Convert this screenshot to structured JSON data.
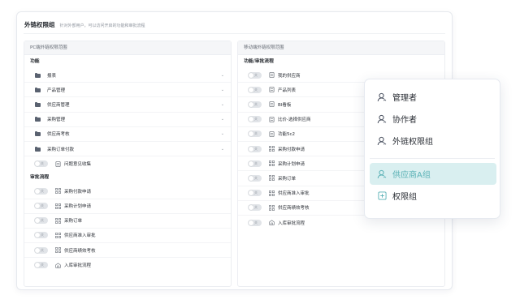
{
  "card": {
    "title": "外链权限组",
    "description": "针对外部用户，可以访问开启的功能和审批流程"
  },
  "left_panel": {
    "header": "PC端外链权限范围",
    "functions_label": "功能",
    "function_items": [
      {
        "label": "报表"
      },
      {
        "label": "产品管理"
      },
      {
        "label": "供应商管理"
      },
      {
        "label": "采购管理"
      },
      {
        "label": "供应商考核"
      },
      {
        "label": "采购订单付款"
      }
    ],
    "function_toggle_items": [
      {
        "label": "问题意见收集",
        "toggle_text": "关"
      }
    ],
    "approval_label": "审批流程",
    "approval_items": [
      {
        "label": "采购付款申请",
        "toggle_text": "关"
      },
      {
        "label": "采购计划申请",
        "toggle_text": "关"
      },
      {
        "label": "采购订单",
        "toggle_text": "关"
      },
      {
        "label": "供应商准入审批",
        "toggle_text": "关"
      },
      {
        "label": "供应商绩效考核",
        "toggle_text": "关"
      },
      {
        "label": "入库审批流程",
        "toggle_text": "关"
      }
    ]
  },
  "right_panel": {
    "header": "移动端外链权限范围",
    "section_label": "功能/审批流程",
    "items": [
      {
        "label": "我的供应商",
        "toggle_text": "关"
      },
      {
        "label": "产品列表",
        "toggle_text": "关"
      },
      {
        "label": "BI看板",
        "toggle_text": "关"
      },
      {
        "label": "比价-选择供应商",
        "toggle_text": "关"
      },
      {
        "label": "功能5c2",
        "toggle_text": "关"
      },
      {
        "label": "采购付款申请",
        "toggle_text": "关"
      },
      {
        "label": "采购计划申请",
        "toggle_text": "关"
      },
      {
        "label": "采购订单",
        "toggle_text": "关"
      },
      {
        "label": "供应商准入审批",
        "toggle_text": "关"
      },
      {
        "label": "供应商绩效考核",
        "toggle_text": "关"
      },
      {
        "label": "入库审批流程",
        "toggle_text": "关"
      }
    ]
  },
  "popup_menu": {
    "items": [
      {
        "label": "管理者",
        "icon": "user-icon"
      },
      {
        "label": "协作者",
        "icon": "user-icon"
      },
      {
        "label": "外链权限组",
        "icon": "user-icon"
      },
      {
        "label": "供应商A组",
        "icon": "user-icon",
        "active": true
      },
      {
        "label": "权限组",
        "icon": "plus-square-icon"
      }
    ]
  },
  "colors": {
    "accent": "#5bb2b6",
    "active_bg": "#d9eff0"
  }
}
